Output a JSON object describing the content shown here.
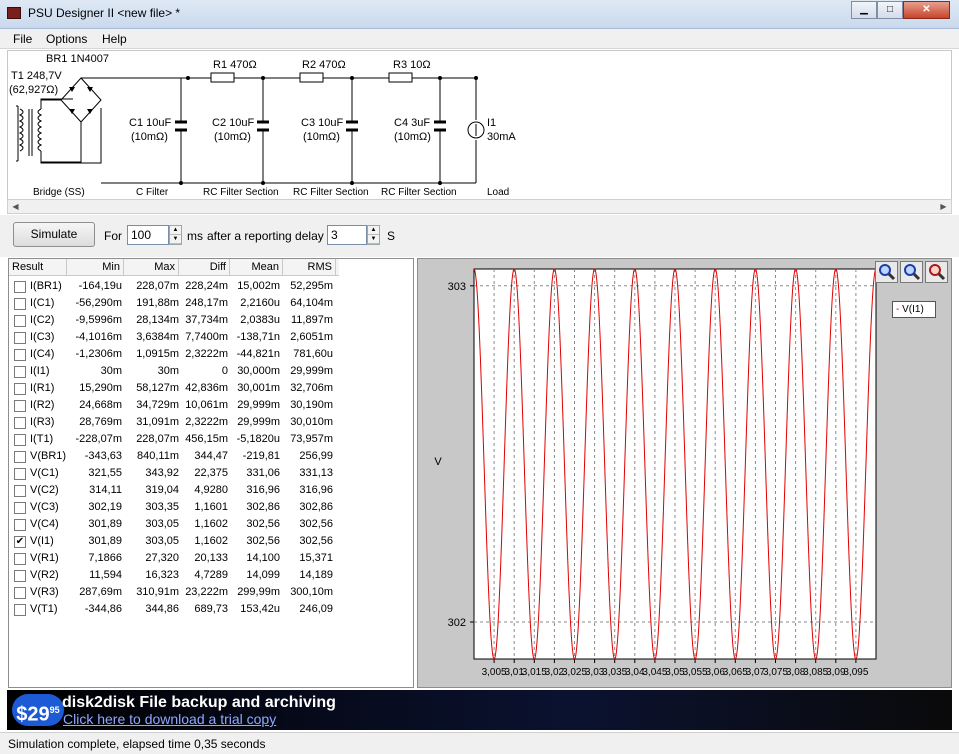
{
  "window": {
    "title": "PSU Designer II  <new file> *",
    "min": "▁",
    "max": "□",
    "close": "✕"
  },
  "menu": [
    "File",
    "Options",
    "Help"
  ],
  "schematic": {
    "t1": "T1 248,7V",
    "t1_res": "(62,927Ω)",
    "br1": "BR1 1N4007",
    "r1": "R1 470Ω",
    "r2": "R2 470Ω",
    "r3": "R3 10Ω",
    "c1": [
      "C1 10uF",
      "(10mΩ)"
    ],
    "c2": [
      "C2 10uF",
      "(10mΩ)"
    ],
    "c3": [
      "C3 10uF",
      "(10mΩ)"
    ],
    "c4": [
      "C4 3uF",
      "(10mΩ)"
    ],
    "i1": [
      "I1",
      "30mA"
    ],
    "sections": [
      "Bridge (SS)",
      "C Filter",
      "RC Filter Section",
      "RC Filter Section",
      "RC Filter Section",
      "Load"
    ]
  },
  "controls": {
    "simulate": "Simulate",
    "for_label": "For",
    "duration": "100",
    "ms_label": "ms",
    "delay_label": "after a reporting delay of",
    "delay": "3",
    "s_label": "S"
  },
  "table": {
    "headers": [
      "Result",
      "Min",
      "Max",
      "Diff",
      "Mean",
      "RMS"
    ],
    "rows": [
      {
        "name": "I(BR1)",
        "checked": false,
        "min": "-164,19u",
        "max": "228,07m",
        "diff": "228,24m",
        "mean": "15,002m",
        "rms": "52,295m"
      },
      {
        "name": "I(C1)",
        "checked": false,
        "min": "-56,290m",
        "max": "191,88m",
        "diff": "248,17m",
        "mean": "2,2160u",
        "rms": "64,104m"
      },
      {
        "name": "I(C2)",
        "checked": false,
        "min": "-9,5996m",
        "max": "28,134m",
        "diff": "37,734m",
        "mean": "2,0383u",
        "rms": "11,897m"
      },
      {
        "name": "I(C3)",
        "checked": false,
        "min": "-4,1016m",
        "max": "3,6384m",
        "diff": "7,7400m",
        "mean": "-138,71n",
        "rms": "2,6051m"
      },
      {
        "name": "I(C4)",
        "checked": false,
        "min": "-1,2306m",
        "max": "1,0915m",
        "diff": "2,3222m",
        "mean": "-44,821n",
        "rms": "781,60u"
      },
      {
        "name": "I(I1)",
        "checked": false,
        "min": "30m",
        "max": "30m",
        "diff": "0",
        "mean": "30,000m",
        "rms": "29,999m"
      },
      {
        "name": "I(R1)",
        "checked": false,
        "min": "15,290m",
        "max": "58,127m",
        "diff": "42,836m",
        "mean": "30,001m",
        "rms": "32,706m"
      },
      {
        "name": "I(R2)",
        "checked": false,
        "min": "24,668m",
        "max": "34,729m",
        "diff": "10,061m",
        "mean": "29,999m",
        "rms": "30,190m"
      },
      {
        "name": "I(R3)",
        "checked": false,
        "min": "28,769m",
        "max": "31,091m",
        "diff": "2,3222m",
        "mean": "29,999m",
        "rms": "30,010m"
      },
      {
        "name": "I(T1)",
        "checked": false,
        "min": "-228,07m",
        "max": "228,07m",
        "diff": "456,15m",
        "mean": "-5,1820u",
        "rms": "73,957m"
      },
      {
        "name": "V(BR1)",
        "checked": false,
        "min": "-343,63",
        "max": "840,11m",
        "diff": "344,47",
        "mean": "-219,81",
        "rms": "256,99"
      },
      {
        "name": "V(C1)",
        "checked": false,
        "min": "321,55",
        "max": "343,92",
        "diff": "22,375",
        "mean": "331,06",
        "rms": "331,13"
      },
      {
        "name": "V(C2)",
        "checked": false,
        "min": "314,11",
        "max": "319,04",
        "diff": "4,9280",
        "mean": "316,96",
        "rms": "316,96"
      },
      {
        "name": "V(C3)",
        "checked": false,
        "min": "302,19",
        "max": "303,35",
        "diff": "1,1601",
        "mean": "302,86",
        "rms": "302,86"
      },
      {
        "name": "V(C4)",
        "checked": false,
        "min": "301,89",
        "max": "303,05",
        "diff": "1,1602",
        "mean": "302,56",
        "rms": "302,56"
      },
      {
        "name": "V(I1)",
        "checked": true,
        "min": "301,89",
        "max": "303,05",
        "diff": "1,1602",
        "mean": "302,56",
        "rms": "302,56"
      },
      {
        "name": "V(R1)",
        "checked": false,
        "min": "7,1866",
        "max": "27,320",
        "diff": "20,133",
        "mean": "14,100",
        "rms": "15,371"
      },
      {
        "name": "V(R2)",
        "checked": false,
        "min": "11,594",
        "max": "16,323",
        "diff": "4,7289",
        "mean": "14,099",
        "rms": "14,189"
      },
      {
        "name": "V(R3)",
        "checked": false,
        "min": "287,69m",
        "max": "310,91m",
        "diff": "23,222m",
        "mean": "299,99m",
        "rms": "300,10m"
      },
      {
        "name": "V(T1)",
        "checked": false,
        "min": "-344,86",
        "max": "344,86",
        "diff": "689,73",
        "mean": "153,42u",
        "rms": "246,09"
      }
    ]
  },
  "chart_data": {
    "type": "line",
    "ylabel": "V",
    "yticks": [
      "303",
      "302"
    ],
    "ytick_values": [
      303,
      302
    ],
    "xticks": [
      "3,005",
      "3,01",
      "3,015",
      "3,02",
      "3,025",
      "3,03",
      "3,035",
      "3,04",
      "3,045",
      "3,05",
      "3,055",
      "3,06",
      "3,065",
      "3,07",
      "3,075",
      "3,08",
      "3,085",
      "3,09",
      "3,095"
    ],
    "xlim": [
      3.0,
      3.1
    ],
    "ylim": [
      301.89,
      303.05
    ],
    "grid": true,
    "legend": "top-right",
    "series": [
      {
        "name": "V(I1)",
        "color": "#e00000",
        "frequency_hz": 100,
        "min": 301.89,
        "max": 303.05
      }
    ]
  },
  "zoom_icons": [
    "zoom-in-icon",
    "zoom-fit-icon",
    "zoom-out-icon"
  ],
  "ad": {
    "price_main": "$29",
    "price_cents": "95",
    "title": "disk2disk File backup and archiving",
    "link": "Click here to download a trial copy"
  },
  "status": "Simulation complete, elapsed time 0,35 seconds"
}
